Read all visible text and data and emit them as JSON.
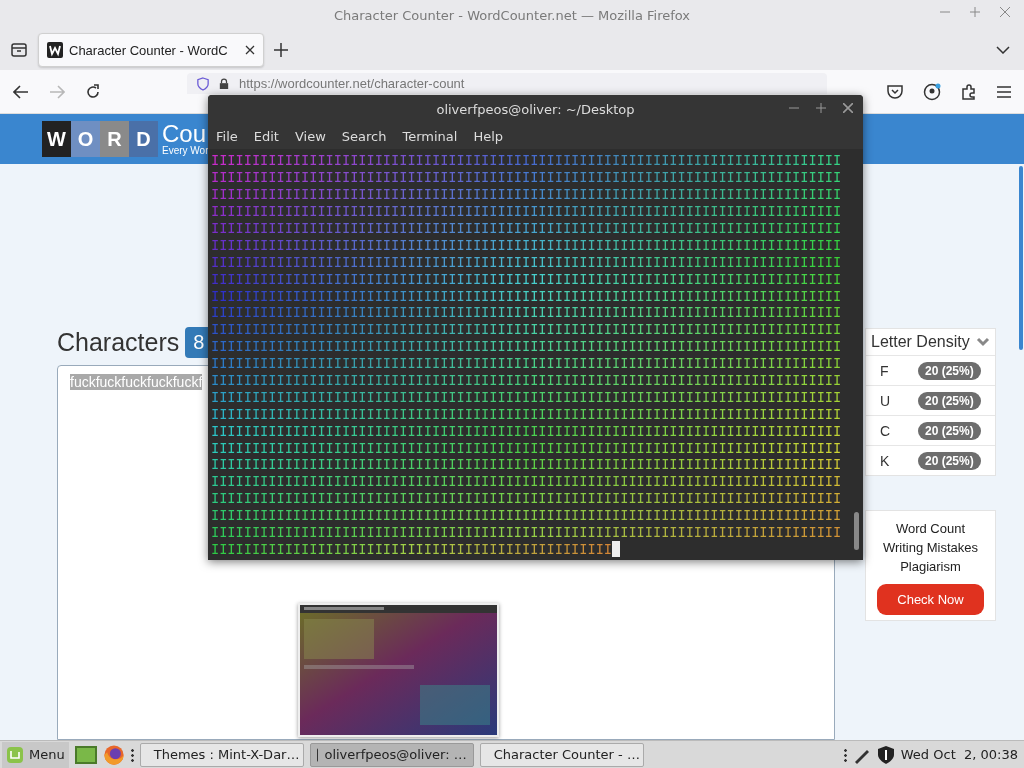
{
  "browser": {
    "title": "Character Counter - WordCounter.net — Mozilla Firefox",
    "tabs": [
      {
        "label": "Character Counter - WordC",
        "selected": true
      }
    ],
    "nav": {
      "forward_disabled": true,
      "url": "https://wordcounter.net/character-count"
    },
    "page": {
      "logo_tiles": [
        "W",
        "O",
        "R",
        "D"
      ],
      "logo_text": "Cou",
      "logo_tagline": "Every Wor",
      "heading": "Characters",
      "count_badge": "8",
      "text_value": "fuckfuckfuckfuckfuckf",
      "letter_density": {
        "title": "Letter Density",
        "rows": [
          {
            "letter": "F",
            "count": "20 (25%)"
          },
          {
            "letter": "U",
            "count": "20 (25%)"
          },
          {
            "letter": "C",
            "count": "20 (25%)"
          },
          {
            "letter": "K",
            "count": "20 (25%)"
          }
        ]
      },
      "ad": {
        "lines": [
          "Word Count",
          "Writing Mistakes",
          "Plagiarism"
        ],
        "button": "Check Now"
      }
    }
  },
  "terminal": {
    "title": "oliverfpeos@oliver: ~/Desktop",
    "menu": [
      "File",
      "Edit",
      "View",
      "Search",
      "Terminal",
      "Help"
    ],
    "lines": [
      "IIIIIIIIIIIIIIIIIIIIIIIIIIIIIIIIIIIIIIIIIIIIIIIIIIIIIIIIIIIIIIIIIIIIIIIIIIIII",
      "IIIIIIIIIIIIIIIIIIIIIIIIIIIIIIIIIIIIIIIIIIIIIIIIIIIIIIIIIIIIIIIIIIIIIIIIIIIII",
      "IIIIIIIIIIIIIIIIIIIIIIIIIIIIIIIIIIIIIIIIIIIIIIIIIIIIIIIIIIIIIIIIIIIIIIIIIIIII",
      "IIIIIIIIIIIIIIIIIIIIIIIIIIIIIIIIIIIIIIIIIIIIIIIIIIIIIIIIIIIIIIIIIIIIIIIIIIIII",
      "IIIIIIIIIIIIIIIIIIIIIIIIIIIIIIIIIIIIIIIIIIIIIIIIIIIIIIIIIIIIIIIIIIIIIIIIIIIII",
      "IIIIIIIIIIIIIIIIIIIIIIIIIIIIIIIIIIIIIIIIIIIIIIIIIIIIIIIIIIIIIIIIIIIIIIIIIIIII",
      "IIIIIIIIIIIIIIIIIIIIIIIIIIIIIIIIIIIIIIIIIIIIIIIIIIIIIIIIIIIIIIIIIIIIIIIIIIIII",
      "IIIIIIIIIIIIIIIIIIIIIIIIIIIIIIIIIIIIIIIIIIIIIIIIIIIIIIIIIIIIIIIIIIIIIIIIIIIII",
      "IIIIIIIIIIIIIIIIIIIIIIIIIIIIIIIIIIIIIIIIIIIIIIIIIIIIIIIIIIIIIIIIIIIIIIIIIIIII",
      "IIIIIIIIIIIIIIIIIIIIIIIIIIIIIIIIIIIIIIIIIIIIIIIIIIIIIIIIIIIIIIIIIIIIIIIIIIIII",
      "IIIIIIIIIIIIIIIIIIIIIIIIIIIIIIIIIIIIIIIIIIIIIIIIIIIIIIIIIIIIIIIIIIIIIIIIIIIII",
      "IIIIIIIIIIIIIIIIIIIIIIIIIIIIIIIIIIIIIIIIIIIIIIIIIIIIIIIIIIIIIIIIIIIIIIIIIIIII",
      "IIIIIIIIIIIIIIIIIIIIIIIIIIIIIIIIIIIIIIIIIIIIIIIIIIIIIIIIIIIIIIIIIIIIIIIIIIIII",
      "IIIIIIIIIIIIIIIIIIIIIIIIIIIIIIIIIIIIIIIIIIIIIIIIIIIIIIIIIIIIIIIIIIIIIIIIIIIII",
      "IIIIIIIIIIIIIIIIIIIIIIIIIIIIIIIIIIIIIIIIIIIIIIIIIIIIIIIIIIIIIIIIIIIIIIIIIIIII",
      "IIIIIIIIIIIIIIIIIIIIIIIIIIIIIIIIIIIIIIIIIIIIIIIIIIIIIIIIIIIIIIIIIIIIIIIIIIIII",
      "IIIIIIIIIIIIIIIIIIIIIIIIIIIIIIIIIIIIIIIIIIIIIIIIIIIIIIIIIIIIIIIIIIIIIIIIIIIII",
      "IIIIIIIIIIIIIIIIIIIIIIIIIIIIIIIIIIIIIIIIIIIIIIIIIIIIIIIIIIIIIIIIIIIIIIIIIIIII",
      "IIIIIIIIIIIIIIIIIIIIIIIIIIIIIIIIIIIIIIIIIIIIIIIIIIIIIIIIIIIIIIIIIIIIIIIIIIIII",
      "IIIIIIIIIIIIIIIIIIIIIIIIIIIIIIIIIIIIIIIIIIIIIIIIIIIIIIIIIIIIIIIIIIIIIIIIIIIII",
      "IIIIIIIIIIIIIIIIIIIIIIIIIIIIIIIIIIIIIIIIIIIIIIIIIIIIIIIIIIIIIIIIIIIIIIIIIIIII",
      "IIIIIIIIIIIIIIIIIIIIIIIIIIIIIIIIIIIIIIIIIIIIIIIIIIIIIIIIIIIIIIIIIIIIIIIIIIIII",
      "IIIIIIIIIIIIIIIIIIIIIIIIIIIIIIIIIIIIIIIIIIIIIIIIIIIIIIIIIIIIIIIIIIIIIIIIIIIII",
      "IIIIIIIIIIIIIIIIIIIIIIIIIIIIIIIIIIIIIIIIIIIIIIIII"
    ]
  },
  "taskbar": {
    "menu_label": "Menu",
    "windows": [
      {
        "label": "Themes : Mint-X-Dar…",
        "selected": false
      },
      {
        "label": "oliverfpeos@oliver: …",
        "selected": true
      },
      {
        "label": "Character Counter - …",
        "selected": false
      }
    ],
    "clock": "Wed Oct  2, 00:38"
  }
}
